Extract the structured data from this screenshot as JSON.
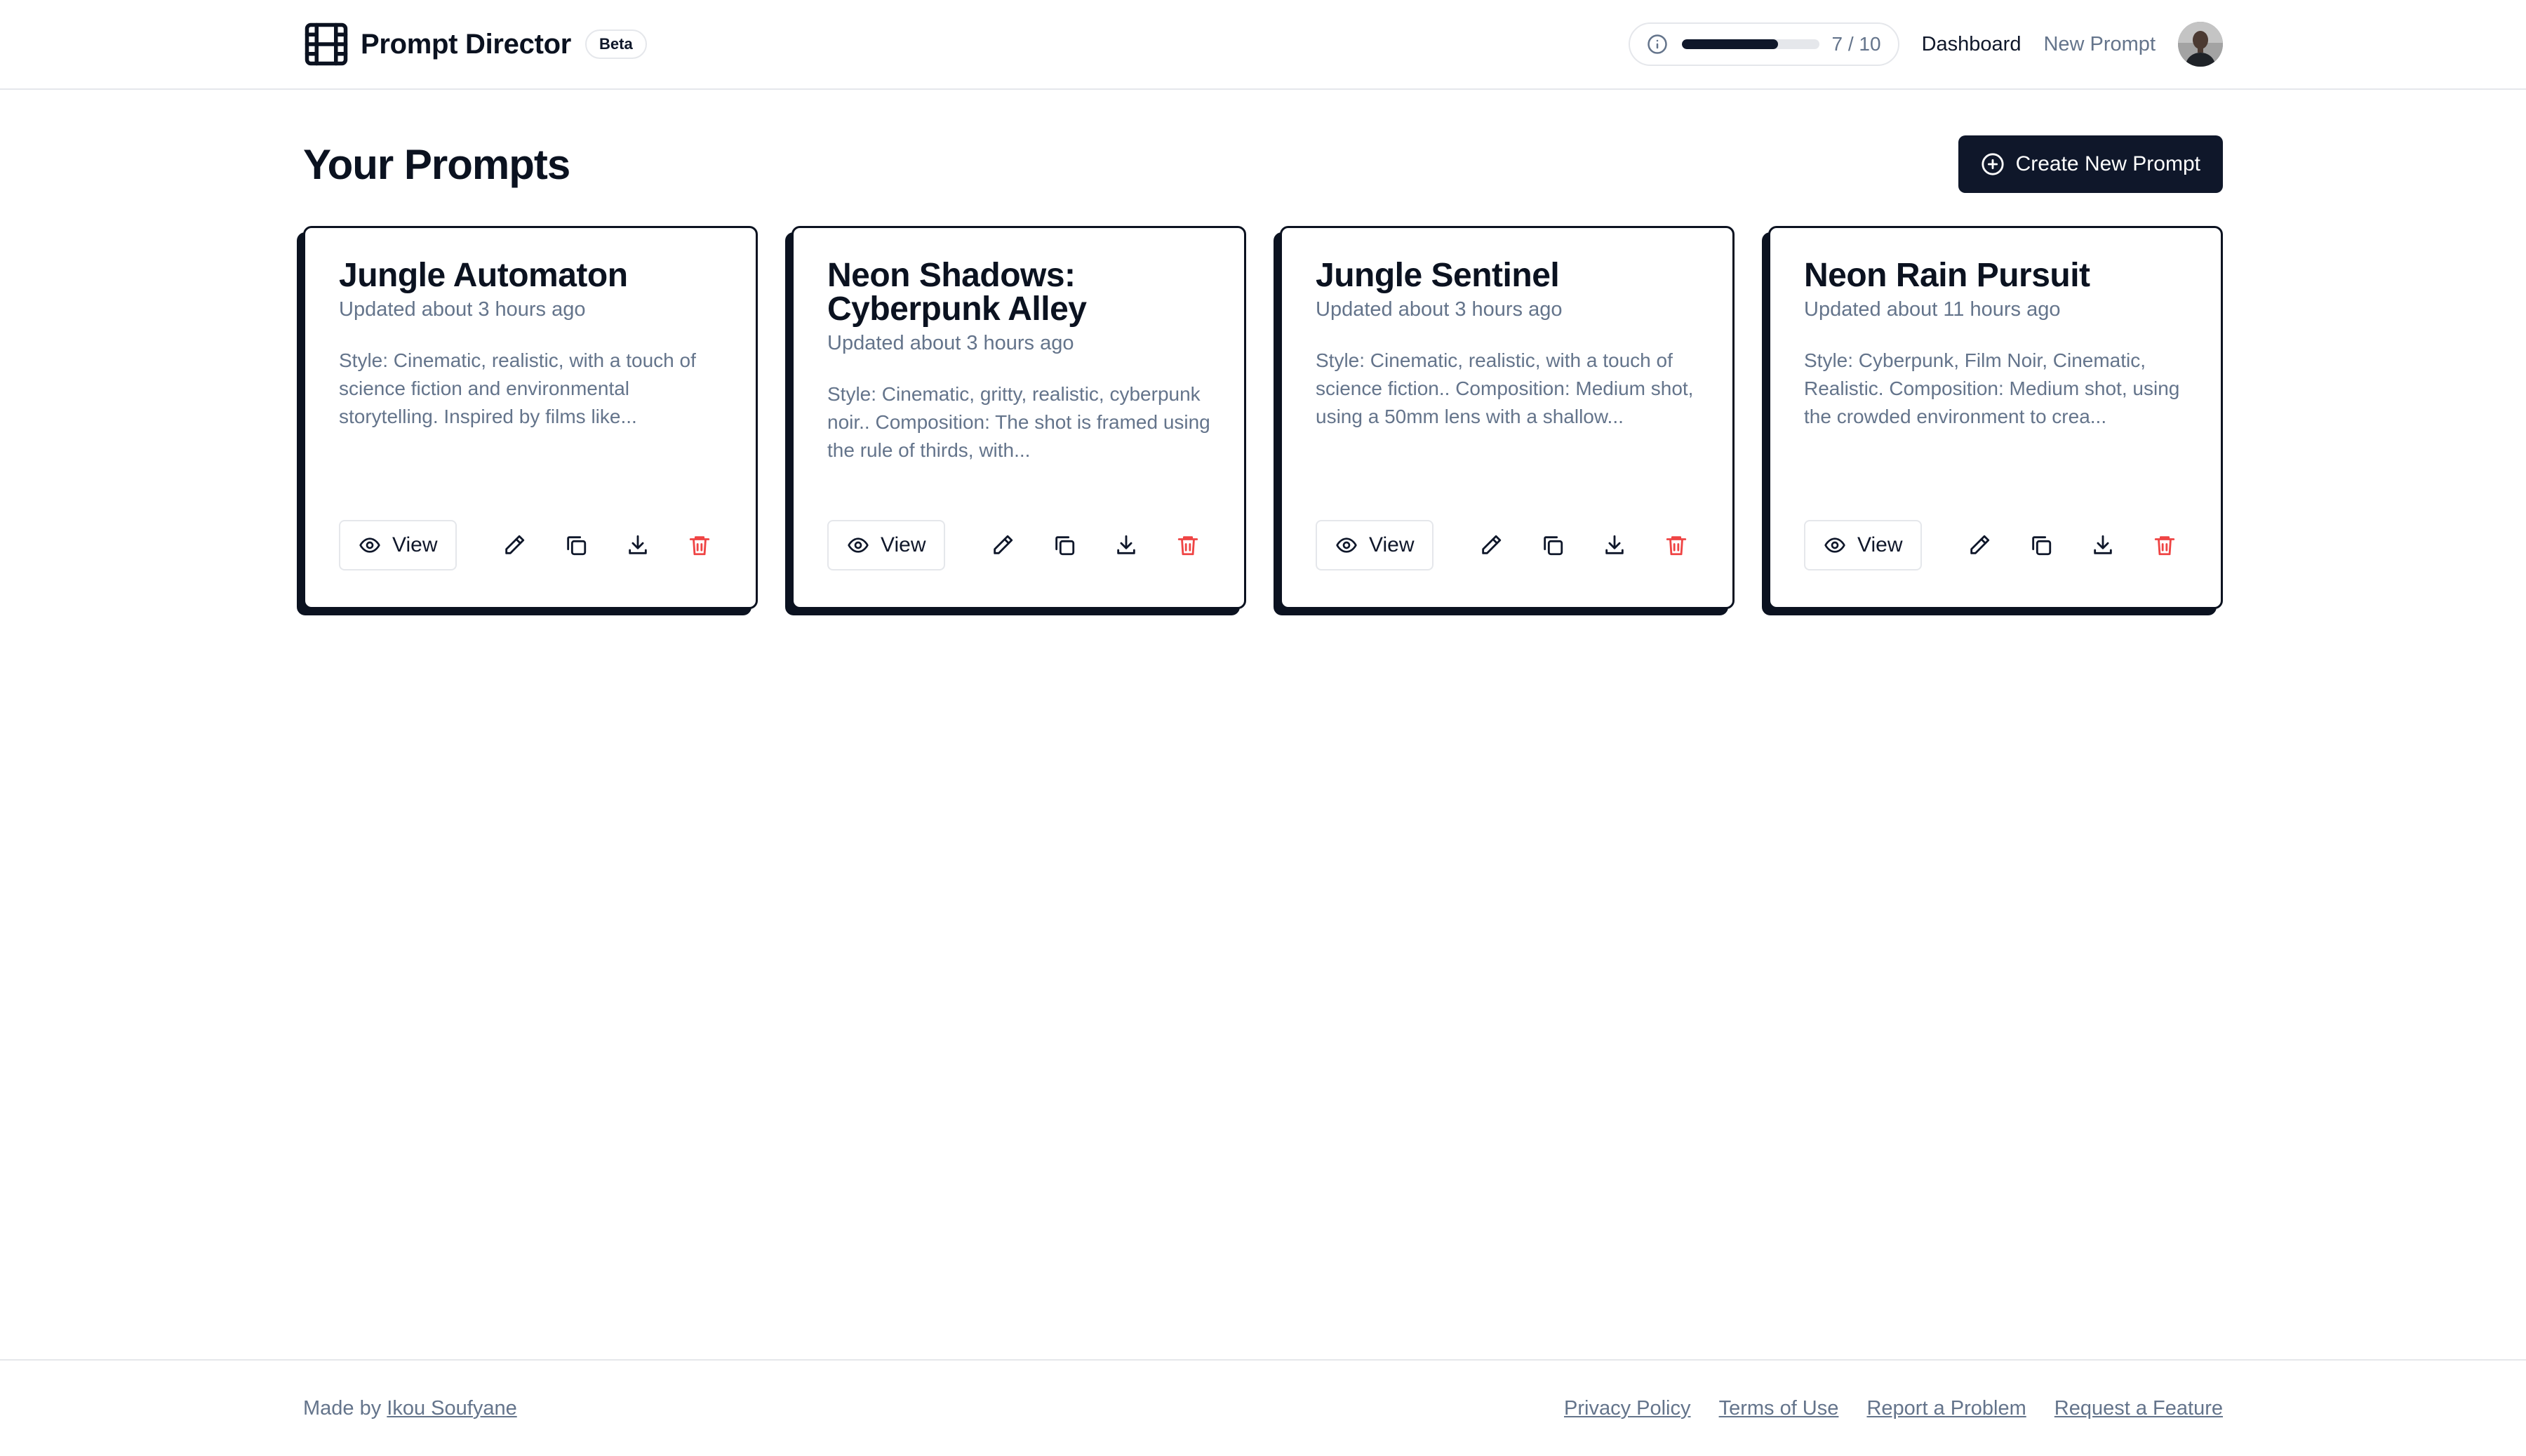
{
  "header": {
    "brand_name": "Prompt Director",
    "beta_label": "Beta",
    "usage": {
      "text": "7 / 10",
      "used": 7,
      "limit": 10
    },
    "nav": {
      "dashboard": "Dashboard",
      "new_prompt": "New Prompt"
    }
  },
  "main": {
    "title": "Your Prompts",
    "create_label": "Create New Prompt",
    "view_label": "View",
    "cards": [
      {
        "title": "Jungle Automaton",
        "updated": "Updated about 3 hours ago",
        "description": "Style: Cinematic, realistic, with a touch of science fiction and environmental storytelling. Inspired by films like..."
      },
      {
        "title": "Neon Shadows: Cyberpunk Alley",
        "updated": "Updated about 3 hours ago",
        "description": "Style: Cinematic, gritty, realistic, cyberpunk noir.. Composition: The shot is framed using the rule of thirds, with..."
      },
      {
        "title": "Jungle Sentinel",
        "updated": "Updated about 3 hours ago",
        "description": "Style: Cinematic, realistic, with a touch of science fiction.. Composition: Medium shot, using a 50mm lens with a shallow..."
      },
      {
        "title": "Neon Rain Pursuit",
        "updated": "Updated about 11 hours ago",
        "description": "Style: Cyberpunk, Film Noir, Cinematic, Realistic. Composition: Medium shot, using the crowded environment to crea..."
      }
    ]
  },
  "footer": {
    "made_by_prefix": "Made by",
    "author": "Ikou Soufyane",
    "links": [
      "Privacy Policy",
      "Terms of Use",
      "Report a Problem",
      "Request a Feature"
    ]
  },
  "colors": {
    "primary": "#0f172a",
    "muted_text": "#64748b",
    "border": "#e5e7eb",
    "danger": "#ef4444"
  },
  "icons": {
    "brand": "film-icon",
    "usage": "info-icon",
    "create": "plus-circle-icon",
    "view": "eye-icon",
    "edit": "pencil-icon",
    "duplicate": "copy-icon",
    "download": "download-icon",
    "delete": "trash-icon"
  }
}
